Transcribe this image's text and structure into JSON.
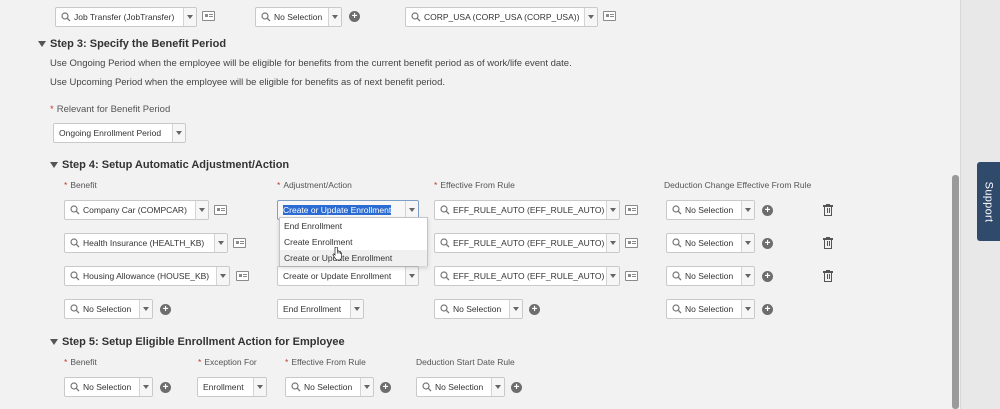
{
  "top_row": {
    "field1": "Job Transfer (JobTransfer)",
    "field2": "No Selection",
    "field3": "CORP_USA (CORP_USA (CORP_USA))"
  },
  "step3": {
    "title": "Step 3: Specify the Benefit Period",
    "note1": "Use Ongoing Period when the employee will be eligible for benefits from the current benefit period as of work/life event date.",
    "note2": "Use Upcoming Period when the employee will be eligible for benefits as of next benefit period.",
    "relevant_label": "Relevant for Benefit Period",
    "relevant_value": "Ongoing Enrollment Period"
  },
  "step4": {
    "title": "Step 4: Setup Automatic Adjustment/Action",
    "col_benefit": "Benefit",
    "col_action": "Adjustment/Action",
    "col_rule": "Effective From Rule",
    "col_deduction": "Deduction Change Effective From Rule",
    "rows": [
      {
        "benefit": "Company Car (COMPCAR)",
        "action": "Create or Update Enrollment",
        "rule": "EFF_RULE_AUTO (EFF_RULE_AUTO)",
        "deduction": "No Selection"
      },
      {
        "benefit": "Health Insurance (HEALTH_KB)",
        "action": "",
        "rule": "EFF_RULE_AUTO (EFF_RULE_AUTO)",
        "deduction": "No Selection"
      },
      {
        "benefit": "Housing Allowance (HOUSE_KB)",
        "action": "Create or Update Enrollment",
        "rule": "EFF_RULE_AUTO (EFF_RULE_AUTO)",
        "deduction": "No Selection"
      },
      {
        "benefit": "No Selection",
        "action": "End Enrollment",
        "rule": "No Selection",
        "deduction": "No Selection"
      }
    ],
    "dropdown_options": [
      "End Enrollment",
      "Create Enrollment",
      "Create or Update Enrollment"
    ]
  },
  "step5": {
    "title": "Step 5: Setup Eligible Enrollment Action for Employee",
    "col_benefit": "Benefit",
    "col_exception": "Exception For",
    "col_rule": "Effective From Rule",
    "col_deduction": "Deduction Start Date Rule",
    "benefit": "No Selection",
    "exception": "Enrollment",
    "rule": "No Selection",
    "deduction": "No Selection"
  },
  "support_label": "Support",
  "required_marker": "*"
}
